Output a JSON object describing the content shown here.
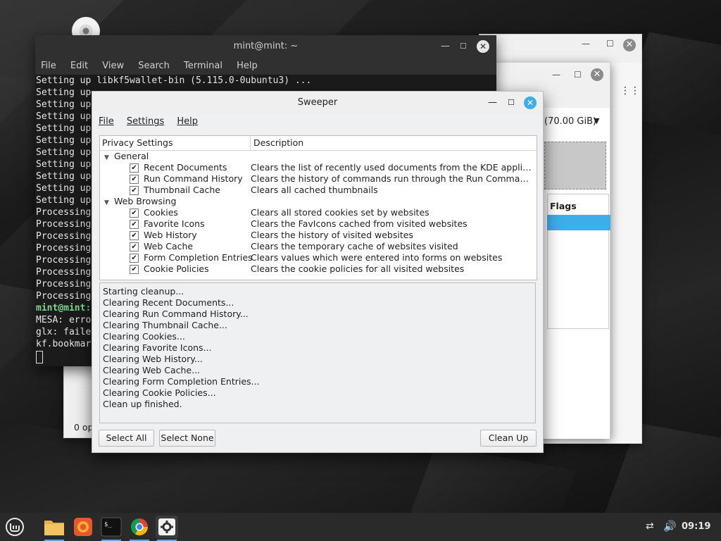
{
  "terminal": {
    "title": "mint@mint: ~",
    "menu": [
      "File",
      "Edit",
      "View",
      "Search",
      "Terminal",
      "Help"
    ],
    "lines": [
      "Setting up libkf5wallet-bin (5.115.0-0ubuntu3) ...",
      "Setting up",
      "Setting up",
      "Setting up",
      "Setting up",
      "Setting up",
      "Setting up",
      "Setting up",
      "Setting up",
      "Setting up",
      "Setting up",
      "Processing",
      "Processing",
      "Processing",
      "Processing",
      "Processing",
      "Processing",
      "Processing",
      "Processing"
    ],
    "prompt": "mint@mint:",
    "tail_lines": [
      "MESA: erro",
      "glx: faile",
      "kf.bookmar"
    ]
  },
  "file_manager": {
    "partition_label": "(70.00 GiB)",
    "flags_header": "Flags",
    "status_text": "0 op"
  },
  "sweeper": {
    "title": "Sweeper",
    "menu": {
      "file": "File",
      "settings": "Settings",
      "help": "Help"
    },
    "columns": {
      "privacy": "Privacy Settings",
      "description": "Description"
    },
    "groups": {
      "general": "General",
      "web": "Web Browsing"
    },
    "general_items": [
      {
        "name": "Recent Documents",
        "desc": "Clears the list of recently used documents from the KDE applicatio..."
      },
      {
        "name": "Run Command History",
        "desc": "Clears the history of commands run through the Run Command to..."
      },
      {
        "name": "Thumbnail Cache",
        "desc": "Clears all cached thumbnails"
      }
    ],
    "web_items": [
      {
        "name": "Cookies",
        "desc": "Clears all stored cookies set by websites"
      },
      {
        "name": "Favorite Icons",
        "desc": "Clears the FavIcons cached from visited websites"
      },
      {
        "name": "Web History",
        "desc": "Clears the history of visited websites"
      },
      {
        "name": "Web Cache",
        "desc": "Clears the temporary cache of websites visited"
      },
      {
        "name": "Form Completion Entries",
        "desc": "Clears values which were entered into forms on websites"
      },
      {
        "name": "Cookie Policies",
        "desc": "Clears the cookie policies for all visited websites"
      }
    ],
    "log": [
      "Starting cleanup...",
      "Clearing Recent Documents...",
      "Clearing Run Command History...",
      "Clearing Thumbnail Cache...",
      "Clearing Cookies...",
      "Clearing Favorite Icons...",
      "Clearing Web History...",
      "Clearing Web Cache...",
      "Clearing Form Completion Entries...",
      "Clearing Cookie Policies...",
      "Clean up finished."
    ],
    "buttons": {
      "select_all": "Select All",
      "select_none": "Select None",
      "clean_up": "Clean Up"
    }
  },
  "taskbar": {
    "clock": "09:19",
    "apps": [
      "menu-icon",
      "files-icon",
      "firefox-icon",
      "terminal-icon",
      "chrome-icon",
      "settings-icon"
    ],
    "accent": "#5aa6e6"
  }
}
